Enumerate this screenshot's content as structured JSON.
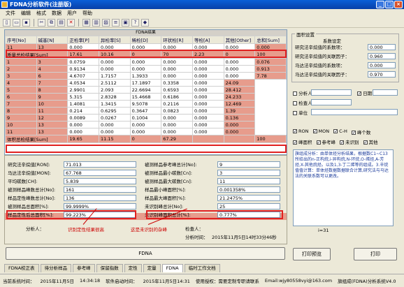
{
  "window": {
    "title": "FDNA分析软件(注册版)"
  },
  "menu": [
    "文件",
    "编辑",
    "格式",
    "数据",
    "用户",
    "帮助"
  ],
  "grid": {
    "caption": "FDNA结果",
    "headers": [
      "序号[No]",
      "碱基[N]",
      "正检率[P]",
      "异检率[S]",
      "稀检[D]",
      "环状检[R]",
      "等检[A]",
      "其他[Other]",
      "总和[Sum]"
    ],
    "rows": [
      [
        "11",
        "13",
        "0.000",
        "0.000",
        "0.000",
        "0.000",
        "0.000",
        "0.000",
        "0.000"
      ],
      [
        "质量总检结果[Sum]",
        "17.61",
        "10.16",
        "0",
        "70",
        "2.23",
        "0",
        "100"
      ],
      [
        "1",
        "3",
        "0.0759",
        "0.000",
        "0.000",
        "0.000",
        "0.000",
        "0.000",
        "0.076"
      ],
      [
        "2",
        "4",
        "0.9134",
        "0.000",
        "0.000",
        "0.000",
        "0.000",
        "0.000",
        "0.913"
      ],
      [
        "3",
        "6",
        "4.6707",
        "1.7157",
        "1.3933",
        "0.000",
        "0.000",
        "0.000",
        "7.78"
      ],
      [
        "4",
        "7",
        "4.0534",
        "2.5112",
        "17.1897",
        "0.3358",
        "0.000",
        "24.09"
      ],
      [
        "5",
        "8",
        "2.9901",
        "2.093",
        "22.6694",
        "0.6593",
        "0.000",
        "28.412"
      ],
      [
        "6",
        "9",
        "5.315",
        "2.8328",
        "15.4668",
        "0.6186",
        "0.000",
        "24.233"
      ],
      [
        "7",
        "10",
        "1.4081",
        "1.3415",
        "9.5078",
        "0.2116",
        "0.000",
        "12.469"
      ],
      [
        "8",
        "11",
        "0.214",
        "0.6295",
        "0.3647",
        "0.0823",
        "0.000",
        "1.39"
      ],
      [
        "9",
        "12",
        "0.0089",
        "0.0267",
        "0.1004",
        "0.000",
        "0.000",
        "0.136"
      ],
      [
        "10",
        "13",
        "0.000",
        "0.000",
        "0.000",
        "0.000",
        "0.000",
        "0.000"
      ],
      [
        "11",
        "13",
        "0.000",
        "0.000",
        "0.000",
        "0.000",
        "0.000",
        "0.000"
      ],
      [
        "体积总检结果[Sum]",
        "19.65",
        "11.15",
        "0",
        "67.29",
        "",
        "",
        "100"
      ]
    ]
  },
  "stats": {
    "left": [
      {
        "label": "研究法辛烷值[RON]:",
        "value": "71.013"
      },
      {
        "label": "马达法辛烷值[MON]:",
        "value": "67.768"
      },
      {
        "label": "平均碳数[CH]:",
        "value": "5.839"
      },
      {
        "label": "被测样品峰数总计[No]:",
        "value": "161"
      },
      {
        "label": "样品定性峰数总计[No]:",
        "value": "136"
      },
      {
        "label": "被测样品总面积[%]:",
        "value": "99.9999%"
      },
      {
        "label": "样品定性后总面积[%]:",
        "value": "99.223%"
      }
    ],
    "right": [
      {
        "label": "被测样品参考峰总计[No]:",
        "value": "9"
      },
      {
        "label": "被测样品最小碳数[Cn]:",
        "value": "3"
      },
      {
        "label": "被测样品最大碳数[Cn]:",
        "value": "11"
      },
      {
        "label": "样品最小峰面积[%]:",
        "value": "0.001358%"
      },
      {
        "label": "样品最大峰面积[%]:",
        "value": "21.2475%"
      },
      {
        "label": "未识别峰总计[No]:",
        "value": "25"
      },
      {
        "label": "未识别峰面积总计[%]:",
        "value": "0.777%"
      }
    ],
    "analyst_label": "分析人：",
    "checker_label": "检查人：",
    "time_label": "分析时间：",
    "time_value": "2015年11月5日14时33分46秒",
    "note1": "识别定性结果很高",
    "note2": "这是未识别的杂峰"
  },
  "right_panel": {
    "group_title": "面积设置",
    "sub_title": "系数设定",
    "coeffs": [
      {
        "label": "研究法辛烷值的系数项：",
        "value": "0.000"
      },
      {
        "label": "研究法辛烷值的关联因子：",
        "value": "0.960"
      },
      {
        "label": "马达法辛烷值的系数项：",
        "value": "0.000"
      },
      {
        "label": "马达法辛烷值的关联因子：",
        "value": "0.970"
      }
    ],
    "analyst": "分析人",
    "date": "日期",
    "checker": "检查人",
    "unit": "单位",
    "checks_row1": [
      "RON",
      "MON",
      "C-H",
      "峰个数"
    ],
    "checks_row2": [
      "峰面积",
      "参考峰",
      "未识别",
      "其他"
    ],
    "description": "旗组成分析：由单体烃分析结果，根据数C1~C13所给出的n-正构烷,i-异构烷,N-环烷,O-烯烃,A-芳烃,X-其他烷烃。以及1,3-丁二烯等的组成。3.辛烷值值计算：单体烃数据数据联合计算,研究法与马达法的关联系数可以更改。",
    "page": "i=31",
    "print_preview": "打印预览",
    "print": "打印"
  },
  "fdna_button": "FDNA",
  "tabs": [
    "FDNA校正表",
    "待分析样品",
    "参考峰",
    "保留指数",
    "定性",
    "定量",
    "FDNA",
    "临时工作文档"
  ],
  "status": {
    "sys_time_label": "当前系统时间：",
    "sys_date": "2015年11月5日",
    "sys_clock": "14:34:18",
    "start_label": "软件启动时间：",
    "start_value": "2015年11月5日14:31",
    "license": "使用授权：需要定制专职请联系",
    "email": "Email:wjy80558vyi@163.com",
    "version": "旗组成(FDNA)分析系统V4.0"
  }
}
